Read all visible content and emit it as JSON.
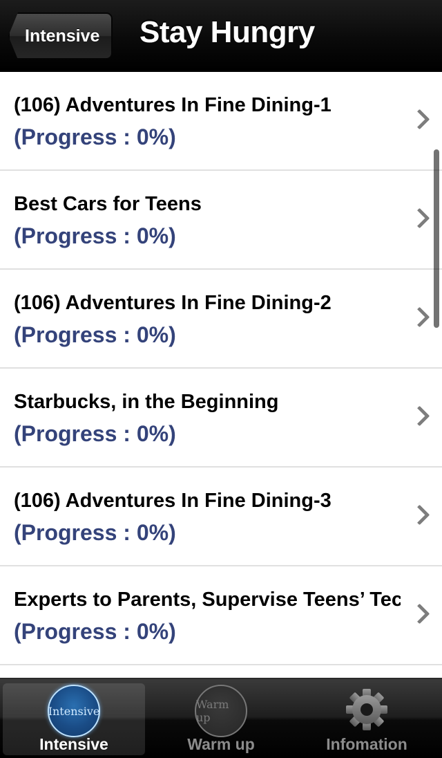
{
  "navbar": {
    "back_label": "Intensive",
    "title": "Stay Hungry"
  },
  "list": {
    "items": [
      {
        "title": "(106) Adventures In Fine Dining-1",
        "progress": "(Progress : 0%)"
      },
      {
        "title": "Best Cars for Teens",
        "progress": "(Progress : 0%)"
      },
      {
        "title": "(106) Adventures In Fine Dining-2",
        "progress": "(Progress : 0%)"
      },
      {
        "title": "Starbucks, in the Beginning",
        "progress": "(Progress : 0%)"
      },
      {
        "title": "(106) Adventures In Fine Dining-3",
        "progress": "(Progress : 0%)"
      },
      {
        "title": "Experts to Parents, Supervise Teens’ Tec",
        "progress": "(Progress : 0%)"
      }
    ]
  },
  "tabbar": {
    "tabs": [
      {
        "label": "Intensive",
        "icon_text": "Intensive",
        "icon": "intensive-circle-icon",
        "selected": true
      },
      {
        "label": "Warm up",
        "icon_text": "Warm up",
        "icon": "warmup-circle-icon",
        "selected": false
      },
      {
        "label": "Infomation",
        "icon": "gear-icon",
        "selected": false
      }
    ]
  },
  "colors": {
    "progress_text": "#34437a",
    "active_icon": "#1a4c86"
  }
}
